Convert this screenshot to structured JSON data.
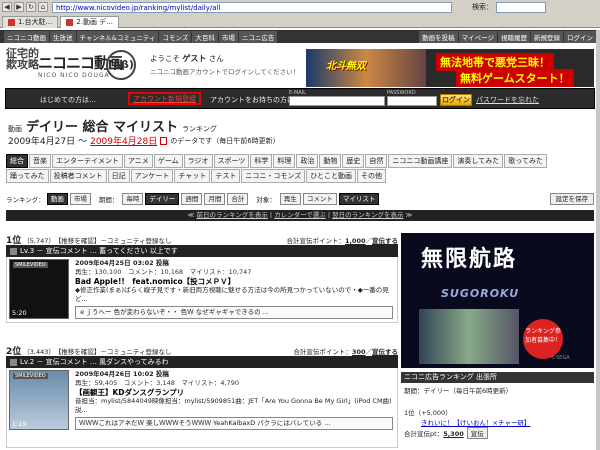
{
  "browser": {
    "url": "http://www.nicovideo.jp/ranking/mylist/daily/all",
    "search_label": "検索：",
    "tabs": [
      "1.台大駐...",
      "2.動画 デ..."
    ]
  },
  "site_nav": {
    "left": [
      "ニコニコ動画",
      "生放送",
      "チャンネル&コミュニティ",
      "コモンズ",
      "大百科",
      "市場",
      "ニコニ広告"
    ],
    "right": [
      "動画を投稿",
      "マイページ",
      "視聴履歴",
      "新規登録",
      "ログイン"
    ]
  },
  "header": {
    "logo_kanji": "征宅的\n欺攻略",
    "logo_main": "ニコニコ動画",
    "logo_sub": "NICO NICO DOUGA",
    "logo_version": "(ββ)",
    "welcome_prefix": "ようこそ",
    "welcome_name": "ゲスト",
    "welcome_suffix": "さん",
    "welcome_sub": "ニコニコ動画アカウントでログインしてください！"
  },
  "banner": {
    "img_text": "北斗無双",
    "line1": "無法地帯で悪党三昧！",
    "line2": "無料ゲームスタート！"
  },
  "login": {
    "first_time": "はじめての方は…",
    "register": "アカウント新規登録",
    "have_account": "アカウントをお持ちの方は…",
    "email_label": "E-MAIL",
    "password_label": "PASSWORD",
    "login_button": "ログイン",
    "forgot": "パスワードを忘れた"
  },
  "ranking": {
    "prefix": "動画",
    "title": "デイリー 総合 マイリスト",
    "suffix": "ランキング",
    "date_from": "2009年4月27日",
    "tilde": "～",
    "date_to": "2009年4月28日",
    "date_note": "のデータです（毎日午前6時更新）"
  },
  "categories": {
    "row1": [
      "総合",
      "音楽",
      "エンターテイメント",
      "アニメ",
      "ゲーム",
      "ラジオ",
      "スポーツ",
      "科学",
      "料理",
      "政治",
      "動物",
      "歴史",
      "自然",
      "ニコニコ動画講座",
      "演奏してみた",
      "歌ってみた"
    ],
    "row2": [
      "踊ってみた",
      "投稿者コメント",
      "日記",
      "アンケート",
      "チャット",
      "テスト",
      "ニコニ・コモンズ",
      "ひとこと動画",
      "その他"
    ],
    "active": "総合"
  },
  "controls": {
    "ranking_label": "ランキング：",
    "ranking_types": [
      "動画",
      "市場"
    ],
    "period_label": "期間：",
    "periods": [
      "毎時",
      "デイリー",
      "週間",
      "月間",
      "合計"
    ],
    "target_label": "対象：",
    "targets": [
      "再生",
      "コメント",
      "マイリスト"
    ],
    "save": "設定を保存"
  },
  "darkbar": {
    "prev": "前日のランキングを表示",
    "calendar": "カレンダーで選ぶ",
    "next": "翌日のランキングを表示"
  },
  "entries": [
    {
      "rank": "1位",
      "score": "（5,747）",
      "recommend": "【推移を確認】",
      "community": "－コミュニティ登録なし",
      "points_label": "合計宣伝ポイント：",
      "points": "1,000",
      "promote": "宣伝する",
      "level_bar": "Lv.3 － 宣伝コメント … 蓄ってください 以上です",
      "tag": "SMILEVIDEO",
      "length": "5:20",
      "datetime": "2009年04月25日 03:02 投稿",
      "stats": "再生：130,100　コメント：10,168　マイリスト：10,747",
      "title": "Bad Apple!!　feat.nomico【投コメＰＶ】",
      "desc": "◆修正作業(まぁ)ばらく線子見です・新旧両方視聴に魅せる方法は今の所見つかっていないので・◆一番の見ど...",
      "comment": "ｅｊうへー 色が変わらないぞ・・ 色Ｗ なぜギャギャできるの ..."
    },
    {
      "rank": "2位",
      "score": "（3,443）",
      "recommend": "【推移を確認】",
      "community": "－コミュニティ登録なし",
      "points_label": "合計宣伝ポイント：",
      "points": "300",
      "promote": "宣伝する",
      "level_bar": "Lv.2 － 宣伝コメント … 風ダンスやってみるわ",
      "tag": "SMILEVIDEO",
      "length": "1:19",
      "datetime": "2009年04月26日 10:02 投稿",
      "stats": "再生：59,405　コメント：3,148　マイリスト：4,790",
      "title": "【画観王】KDダンスグランプリ",
      "desc": "音担当：mylist/5844049映像担当：mylist/5909851曲：JET「Are You Gonna Be My Girl」(iPod CM曲) 説...",
      "comment": "ＷＷＷこれはアネだＷ 楽しＷＷＷそうＷＷＷ YeahKaibaxD バクラにはバレている ..."
    }
  ],
  "ad": {
    "title": "無限航路",
    "subtitle": "SUGOROKU",
    "badge": "ランキング参加者募集中！",
    "copyright": "©SEGA"
  },
  "ad_ranking": {
    "header": "ニコニ広告ランキング 出張所",
    "sub": "期間：デイリー（毎日午前6時更新）",
    "first": "1位（+5,000）",
    "first_title": "きれいに！【けいおん！×チャー研】",
    "points_label": "合計宣伝pt：",
    "points": "5,300",
    "promote": "宣伝"
  }
}
